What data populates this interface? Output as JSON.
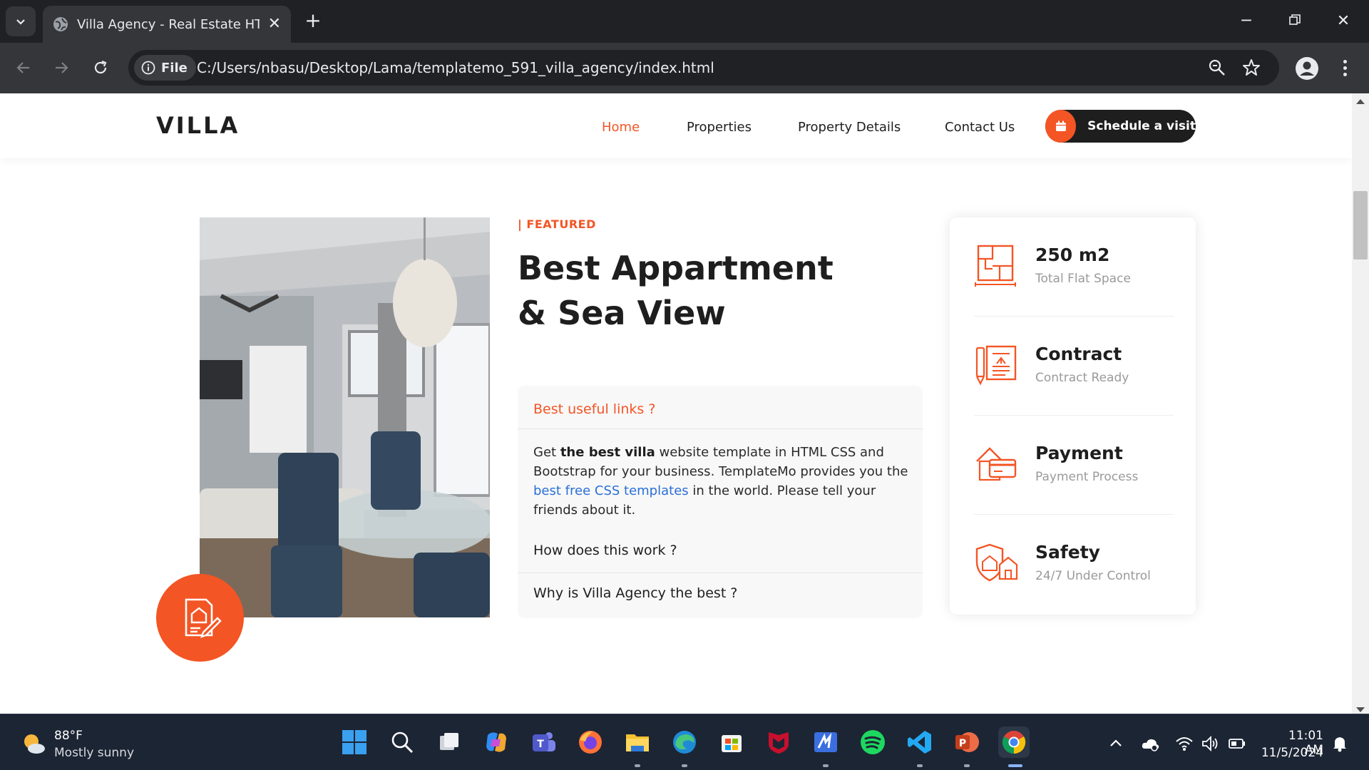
{
  "browser": {
    "tab_title": "Villa Agency - Real Estate HTML",
    "file_chip": "File",
    "url": "C:/Users/nbasu/Desktop/Lama/templatemo_591_villa_agency/index.html"
  },
  "header": {
    "logo": "VILLA",
    "nav": [
      "Home",
      "Properties",
      "Property Details",
      "Contact Us"
    ],
    "active_nav": "Home",
    "cta_label": "Schedule a visit"
  },
  "featured": {
    "tag": "| FEATURED",
    "headline_line1": "Best Appartment",
    "headline_line2": "& Sea View"
  },
  "accordion": {
    "q1": "Best useful links ?",
    "body_1": "Get ",
    "body_bold": "the best villa",
    "body_2": " website template in HTML CSS and Bootstrap for your business. TemplateMo provides you the ",
    "body_link": "best free CSS templates",
    "body_3": " in the world. Please tell your friends about it.",
    "q2": "How does this work ?",
    "q3": "Why is Villa Agency the best ?"
  },
  "info": [
    {
      "title": "250 m2",
      "sub": "Total Flat Space",
      "icon": "floor-plan-icon"
    },
    {
      "title": "Contract",
      "sub": "Contract Ready",
      "icon": "contract-icon"
    },
    {
      "title": "Payment",
      "sub": "Payment Process",
      "icon": "payment-icon"
    },
    {
      "title": "Safety",
      "sub": "24/7 Under Control",
      "icon": "safety-icon"
    }
  ],
  "taskbar": {
    "weather_temp": "88°F",
    "weather_desc": "Mostly sunny",
    "time": "11:01 AM",
    "date": "11/5/2024"
  },
  "colors": {
    "accent": "#f35525",
    "dark": "#1e1e1e",
    "link": "#2a6fd6"
  }
}
